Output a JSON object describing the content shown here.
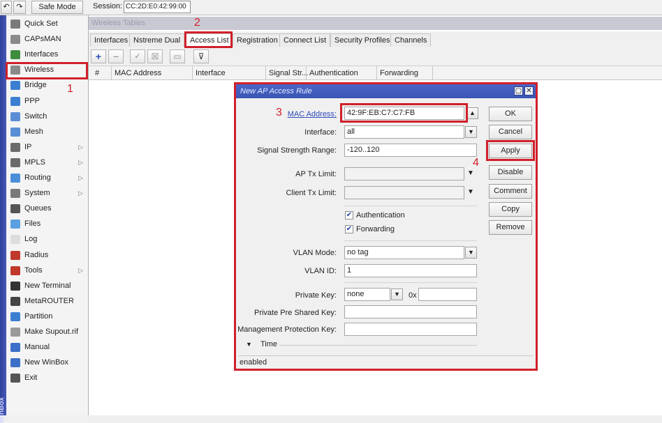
{
  "topbar": {
    "undo_icon": "undo-icon",
    "redo_icon": "redo-icon",
    "safe_mode": "Safe Mode",
    "session_label": "Session:",
    "session_value": "CC:2D:E0:42:99:00"
  },
  "brand": "WinBox",
  "sidebar": {
    "items": [
      {
        "label": "Quick Set",
        "icon": "quickset-icon",
        "color": "#7a7a7a",
        "arrow": false
      },
      {
        "label": "CAPsMAN",
        "icon": "capsman-icon",
        "color": "#8a8a8a",
        "arrow": false
      },
      {
        "label": "Interfaces",
        "icon": "interfaces-icon",
        "color": "#3f8d3f",
        "arrow": false
      },
      {
        "label": "Wireless",
        "icon": "wireless-icon",
        "color": "#8a8a8a",
        "arrow": false
      },
      {
        "label": "Bridge",
        "icon": "bridge-icon",
        "color": "#3c7fd1",
        "arrow": false
      },
      {
        "label": "PPP",
        "icon": "ppp-icon",
        "color": "#3c7fd1",
        "arrow": false
      },
      {
        "label": "Switch",
        "icon": "switch-icon",
        "color": "#5a8fd6",
        "arrow": false
      },
      {
        "label": "Mesh",
        "icon": "mesh-icon",
        "color": "#5a8fd6",
        "arrow": false
      },
      {
        "label": "IP",
        "icon": "ip-icon",
        "color": "#6b6b6b",
        "arrow": true
      },
      {
        "label": "MPLS",
        "icon": "mpls-icon",
        "color": "#6b6b6b",
        "arrow": true
      },
      {
        "label": "Routing",
        "icon": "routing-icon",
        "color": "#4a8ed8",
        "arrow": true
      },
      {
        "label": "System",
        "icon": "system-icon",
        "color": "#7a7a7a",
        "arrow": true
      },
      {
        "label": "Queues",
        "icon": "queues-icon",
        "color": "#555555",
        "arrow": false
      },
      {
        "label": "Files",
        "icon": "files-icon",
        "color": "#5aa0e0",
        "arrow": false
      },
      {
        "label": "Log",
        "icon": "log-icon",
        "color": "#dddddd",
        "arrow": false
      },
      {
        "label": "Radius",
        "icon": "radius-icon",
        "color": "#c0392b",
        "arrow": false
      },
      {
        "label": "Tools",
        "icon": "tools-icon",
        "color": "#c0392b",
        "arrow": true
      },
      {
        "label": "New Terminal",
        "icon": "terminal-icon",
        "color": "#333333",
        "arrow": false
      },
      {
        "label": "MetaROUTER",
        "icon": "metarouter-icon",
        "color": "#444444",
        "arrow": false
      },
      {
        "label": "Partition",
        "icon": "partition-icon",
        "color": "#3c7fd1",
        "arrow": false
      },
      {
        "label": "Make Supout.rif",
        "icon": "supout-icon",
        "color": "#9a9a9a",
        "arrow": false
      },
      {
        "label": "Manual",
        "icon": "manual-icon",
        "color": "#3c6fc7",
        "arrow": false
      },
      {
        "label": "New WinBox",
        "icon": "winbox-icon",
        "color": "#3c6fc7",
        "arrow": false
      },
      {
        "label": "Exit",
        "icon": "exit-icon",
        "color": "#555555",
        "arrow": false
      }
    ]
  },
  "window_title": "Wireless Tables",
  "tabs": [
    "Interfaces",
    "Nstreme Dual",
    "Access List",
    "Registration",
    "Connect List",
    "Security Profiles",
    "Channels"
  ],
  "toolbar_icons": [
    "add-icon",
    "remove-icon",
    "enable-icon",
    "disable-icon",
    "comment-icon",
    "filter-icon"
  ],
  "columns": [
    "#",
    "MAC Address",
    "Interface",
    "Signal Str...",
    "Authentication",
    "Forwarding"
  ],
  "dialog": {
    "title": "New AP Access Rule",
    "fields": {
      "mac_label": "MAC Address:",
      "mac_value": "42:9F:EB:C7:C7:FB",
      "interface_label": "Interface:",
      "interface_value": "all",
      "signal_label": "Signal Strength Range:",
      "signal_value": "-120..120",
      "ap_tx_label": "AP Tx Limit:",
      "ap_tx_value": "",
      "client_tx_label": "Client Tx Limit:",
      "client_tx_value": "",
      "auth_label": "Authentication",
      "auth_checked": true,
      "fwd_label": "Forwarding",
      "fwd_checked": true,
      "vlan_mode_label": "VLAN Mode:",
      "vlan_mode_value": "no tag",
      "vlan_id_label": "VLAN ID:",
      "vlan_id_value": "1",
      "private_key_label": "Private Key:",
      "private_key_value": "none",
      "private_key_hex_prefix": "0x",
      "private_key_hex": "",
      "psk_label": "Private Pre Shared Key:",
      "psk_value": "",
      "mgmt_label": "Management Protection Key:",
      "mgmt_value": "",
      "time_label": "Time"
    },
    "buttons": [
      "OK",
      "Cancel",
      "Apply",
      "Disable",
      "Comment",
      "Copy",
      "Remove"
    ],
    "status": "enabled"
  },
  "annotations": [
    "1",
    "2",
    "3",
    "4"
  ],
  "colors": {
    "annotation_red": "#d0202a",
    "title_blue": "#3b55b3"
  }
}
